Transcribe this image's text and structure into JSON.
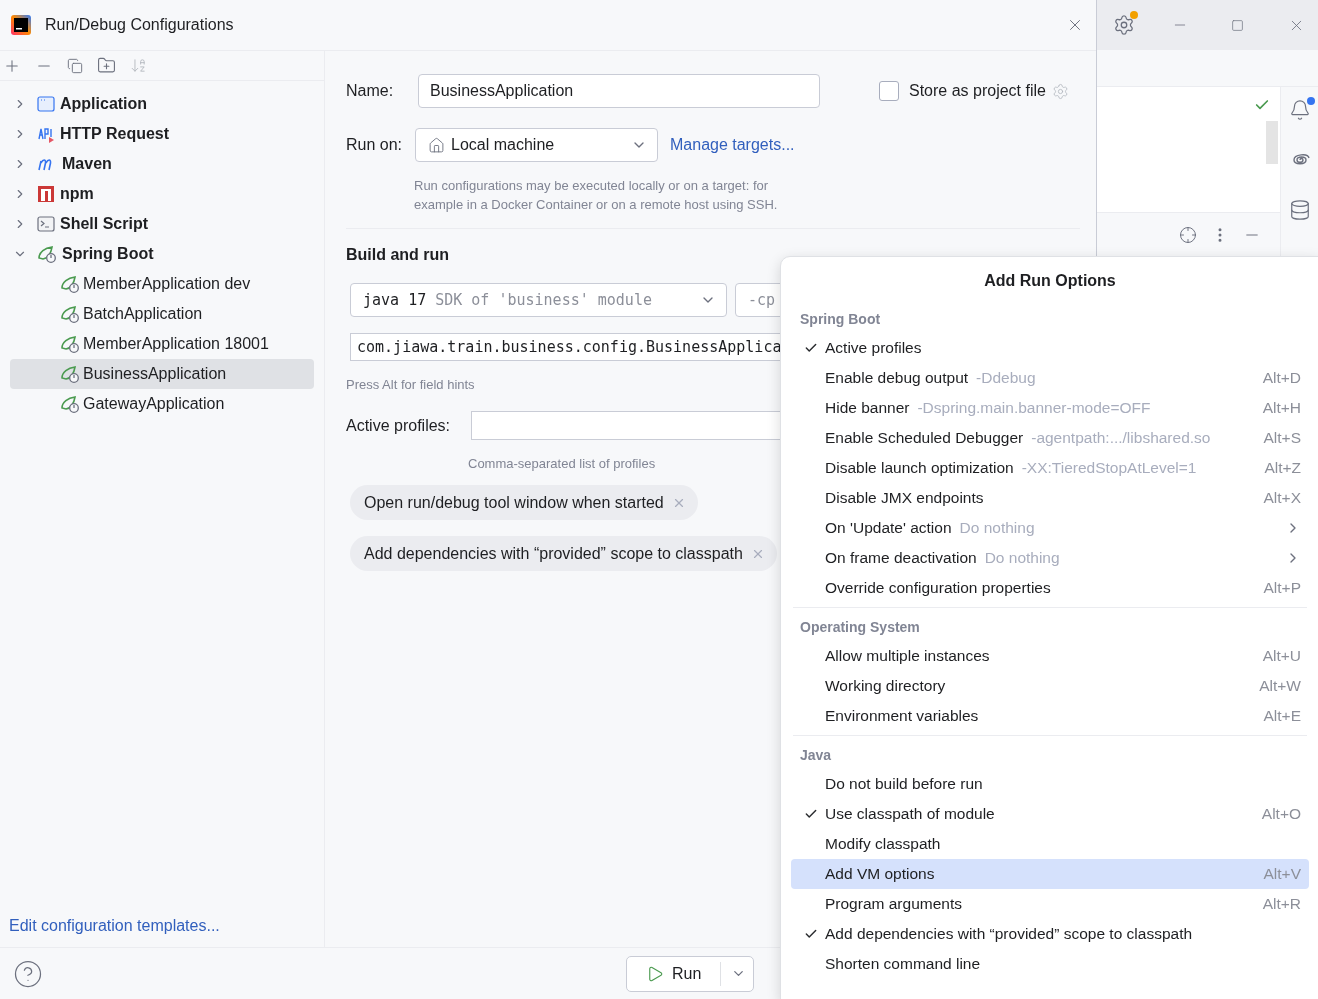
{
  "window": {
    "title": "Run/Debug Configurations"
  },
  "tree": [
    {
      "label": "Application",
      "kind": "application",
      "expanded": false,
      "selected": false
    },
    {
      "label": "HTTP Request",
      "kind": "http",
      "expanded": false,
      "selected": false
    },
    {
      "label": "Maven",
      "kind": "maven",
      "expanded": false,
      "selected": false
    },
    {
      "label": "npm",
      "kind": "npm",
      "expanded": false,
      "selected": false
    },
    {
      "label": "Shell Script",
      "kind": "shell",
      "expanded": false,
      "selected": false
    },
    {
      "label": "Spring Boot",
      "kind": "spring",
      "expanded": true,
      "selected": false,
      "children": [
        {
          "label": "MemberApplication dev",
          "kind": "spring",
          "selected": false
        },
        {
          "label": "BatchApplication",
          "kind": "spring",
          "selected": false
        },
        {
          "label": "MemberApplication 18001",
          "kind": "spring",
          "selected": false
        },
        {
          "label": "BusinessApplication",
          "kind": "spring",
          "selected": true
        },
        {
          "label": "GatewayApplication",
          "kind": "spring",
          "selected": false
        }
      ]
    }
  ],
  "edit_templates_link": "Edit configuration templates...",
  "form": {
    "name_label": "Name:",
    "name_value": "BusinessApplication",
    "store_as_project_file": {
      "label": "Store as project file",
      "checked": false
    },
    "run_on_label": "Run on:",
    "run_on_value": "Local machine",
    "manage_targets_link": "Manage targets...",
    "run_on_hint": [
      "Run configurations may be executed locally or on a target: for",
      "example in a Docker Container or on a remote host using SSH."
    ],
    "section_title": "Build and run",
    "sdk_value": "java 17",
    "sdk_hint": "SDK of 'business' module",
    "cp_field": "-cp",
    "main_class": "com.jiawa.train.business.config.BusinessApplica",
    "field_hints": "Press Alt for field hints",
    "active_profiles_label": "Active profiles:",
    "active_profiles_hint": "Comma-separated list of profiles",
    "chips": [
      "Open run/debug tool window when started",
      "Add dependencies with “provided” scope to classpath"
    ]
  },
  "run_button": "Run",
  "popup": {
    "title": "Add Run Options",
    "sections": [
      {
        "title": "Spring Boot",
        "items": [
          {
            "label": "Active profiles",
            "checked": true,
            "selected": false,
            "submenu": false
          },
          {
            "label": "Enable debug output",
            "hint": "-Ddebug",
            "shortcut": "Alt+D",
            "checked": false,
            "selected": false,
            "submenu": false
          },
          {
            "label": "Hide banner",
            "hint": "-Dspring.main.banner-mode=OFF",
            "shortcut": "Alt+H",
            "checked": false,
            "selected": false,
            "submenu": false
          },
          {
            "label": "Enable Scheduled Debugger",
            "hint": "-agentpath:.../libshared.so",
            "shortcut": "Alt+S",
            "checked": false,
            "selected": false,
            "submenu": false
          },
          {
            "label": "Disable launch optimization",
            "hint": "-XX:TieredStopAtLevel=1",
            "shortcut": "Alt+Z",
            "checked": false,
            "selected": false,
            "submenu": false
          },
          {
            "label": "Disable JMX endpoints",
            "shortcut": "Alt+X",
            "checked": false,
            "selected": false,
            "submenu": false
          },
          {
            "label": "On 'Update' action",
            "hint": "Do nothing",
            "checked": false,
            "selected": false,
            "submenu": true
          },
          {
            "label": "On frame deactivation",
            "hint": "Do nothing",
            "checked": false,
            "selected": false,
            "submenu": true
          },
          {
            "label": "Override configuration properties",
            "shortcut": "Alt+P",
            "checked": false,
            "selected": false,
            "submenu": false
          }
        ]
      },
      {
        "title": "Operating System",
        "items": [
          {
            "label": "Allow multiple instances",
            "shortcut": "Alt+U",
            "checked": false,
            "selected": false,
            "submenu": false
          },
          {
            "label": "Working directory",
            "shortcut": "Alt+W",
            "checked": false,
            "selected": false,
            "submenu": false
          },
          {
            "label": "Environment variables",
            "shortcut": "Alt+E",
            "checked": false,
            "selected": false,
            "submenu": false
          }
        ]
      },
      {
        "title": "Java",
        "items": [
          {
            "label": "Do not build before run",
            "checked": false,
            "selected": false,
            "submenu": false
          },
          {
            "label": "Use classpath of module",
            "shortcut": "Alt+O",
            "checked": true,
            "selected": false,
            "submenu": false
          },
          {
            "label": "Modify classpath",
            "checked": false,
            "selected": false,
            "submenu": false
          },
          {
            "label": "Add VM options",
            "shortcut": "Alt+V",
            "checked": false,
            "selected": true,
            "submenu": false
          },
          {
            "label": "Program arguments",
            "shortcut": "Alt+R",
            "checked": false,
            "selected": false,
            "submenu": false
          },
          {
            "label": "Add dependencies with “provided” scope to classpath",
            "checked": true,
            "selected": false,
            "submenu": false
          },
          {
            "label": "Shorten command line",
            "checked": false,
            "selected": false,
            "submenu": false
          }
        ]
      }
    ]
  }
}
